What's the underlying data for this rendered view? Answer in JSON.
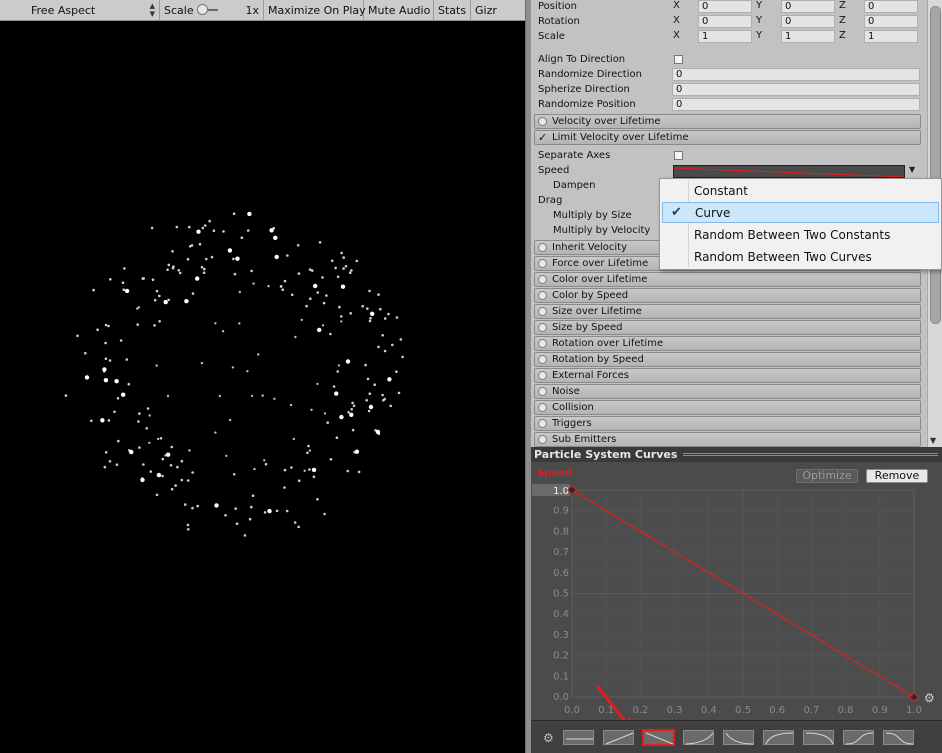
{
  "game_toolbar": {
    "aspect": "Free Aspect",
    "scale_label": "Scale",
    "scale_value": "1x",
    "maximize": "Maximize On Play",
    "mute": "Mute Audio",
    "stats": "Stats",
    "gizmos": "Gizr"
  },
  "inspector": {
    "transform": [
      {
        "label": "Position",
        "x": "0",
        "y": "0",
        "z": "0"
      },
      {
        "label": "Rotation",
        "x": "0",
        "y": "0",
        "z": "0"
      },
      {
        "label": "Scale",
        "x": "1",
        "y": "1",
        "z": "1"
      }
    ],
    "axis_x": "X",
    "axis_y": "Y",
    "axis_z": "Z",
    "align_to_direction": "Align To Direction",
    "randomize_direction": {
      "label": "Randomize Direction",
      "value": "0"
    },
    "spherize_direction": {
      "label": "Spherize Direction",
      "value": "0"
    },
    "randomize_position": {
      "label": "Randomize Position",
      "value": "0"
    },
    "velocity_over_lifetime": "Velocity over Lifetime",
    "limit_velocity": "Limit Velocity over Lifetime",
    "limit_check": "✓",
    "separate_axes": "Separate Axes",
    "speed": "Speed",
    "dampen": "Dampen",
    "drag": "Drag",
    "multiply_by_size": "Multiply by Size",
    "multiply_by_velocity": "Multiply by Velocity",
    "modules": [
      "Inherit Velocity",
      "Force over Lifetime",
      "Color over Lifetime",
      "Color by Speed",
      "Size over Lifetime",
      "Size by Speed",
      "Rotation over Lifetime",
      "Rotation by Speed",
      "External Forces",
      "Noise",
      "Collision",
      "Triggers",
      "Sub Emitters"
    ]
  },
  "menu": {
    "items": [
      "Constant",
      "Curve",
      "Random Between Two Constants",
      "Random Between Two Curves"
    ],
    "selected": "Curve",
    "check": "✔"
  },
  "curves": {
    "title": "Particle System Curves",
    "curve_label": "Speed",
    "max_value": "1.0",
    "optimize": "Optimize",
    "remove": "Remove",
    "y_ticks": [
      "0.9",
      "0.8",
      "0.7",
      "0.6",
      "0.5",
      "0.4",
      "0.3",
      "0.2",
      "0.1",
      "0.0"
    ],
    "x_ticks": [
      "0.0",
      "0.1",
      "0.2",
      "0.3",
      "0.4",
      "0.5",
      "0.6",
      "0.7",
      "0.8",
      "0.9",
      "1.0"
    ],
    "keys": [
      {
        "t": 0.0,
        "v": 1.0
      },
      {
        "t": 1.0,
        "v": 0.0
      }
    ],
    "curve_color": "#e01f1f"
  }
}
